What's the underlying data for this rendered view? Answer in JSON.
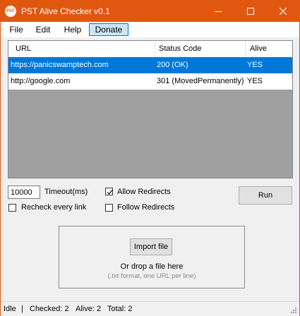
{
  "window": {
    "title": "PST Alive Checker v0.1",
    "icon_text": "PST",
    "accent_color": "#e2570f"
  },
  "menu": [
    {
      "label": "File"
    },
    {
      "label": "Edit"
    },
    {
      "label": "Help"
    },
    {
      "label": "Donate",
      "highlighted": true
    }
  ],
  "table": {
    "columns": [
      "URL",
      "Status Code",
      "Alive"
    ],
    "rows": [
      {
        "url": "https://panicswamptech.com",
        "status": "200 (OK)",
        "alive": "YES",
        "selected": true
      },
      {
        "url": "http://google.com",
        "status": "301 (MovedPermanently)",
        "alive": "YES",
        "selected": false
      }
    ]
  },
  "controls": {
    "timeout_value": "10000",
    "timeout_label": "Timeout(ms)",
    "allow_redirects": {
      "label": "Allow Redirects",
      "checked": true
    },
    "recheck": {
      "label": "Recheck every link",
      "checked": false
    },
    "follow_redirects": {
      "label": "Follow Redirects",
      "checked": false
    },
    "run_label": "Run"
  },
  "drop_zone": {
    "import_label": "Import file",
    "drop_text": "Or drop a file here",
    "hint": "(.txt format, one URL per line)"
  },
  "status_bar": {
    "state": "Idle",
    "separator": "|",
    "checked": "Checked: 2",
    "alive": "Alive: 2",
    "total": "Total: 2"
  }
}
